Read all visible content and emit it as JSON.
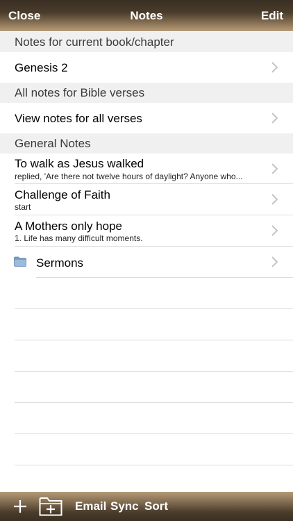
{
  "navbar": {
    "close_label": "Close",
    "title": "Notes",
    "edit_label": "Edit"
  },
  "sections": {
    "current": {
      "header": "Notes for current book/chapter",
      "row": {
        "title": "Genesis 2"
      }
    },
    "bible": {
      "header": "All notes for Bible verses",
      "row": {
        "title": "View notes for all verses"
      }
    },
    "general": {
      "header": "General Notes",
      "notes": [
        {
          "title": "To walk as Jesus walked",
          "preview": "replied, 'Are there not twelve hours of daylight? Anyone who..."
        },
        {
          "title": "Challenge of Faith",
          "preview": "start"
        },
        {
          "title": "A Mothers only hope",
          "preview": "1.  Life has many difficult moments."
        }
      ],
      "folder": {
        "title": "Sermons",
        "icon": "folder-icon"
      }
    }
  },
  "toolbar": {
    "add_icon": "plus-icon",
    "new_folder_icon": "folder-add-icon",
    "email_label": "Email",
    "sync_label": "Sync",
    "sort_label": "Sort"
  },
  "colors": {
    "bar_dark": "#3a2f23",
    "bar_light": "#b79c78",
    "section_bg": "#f0f0f0",
    "folder_blue": "#7a9fc6"
  }
}
